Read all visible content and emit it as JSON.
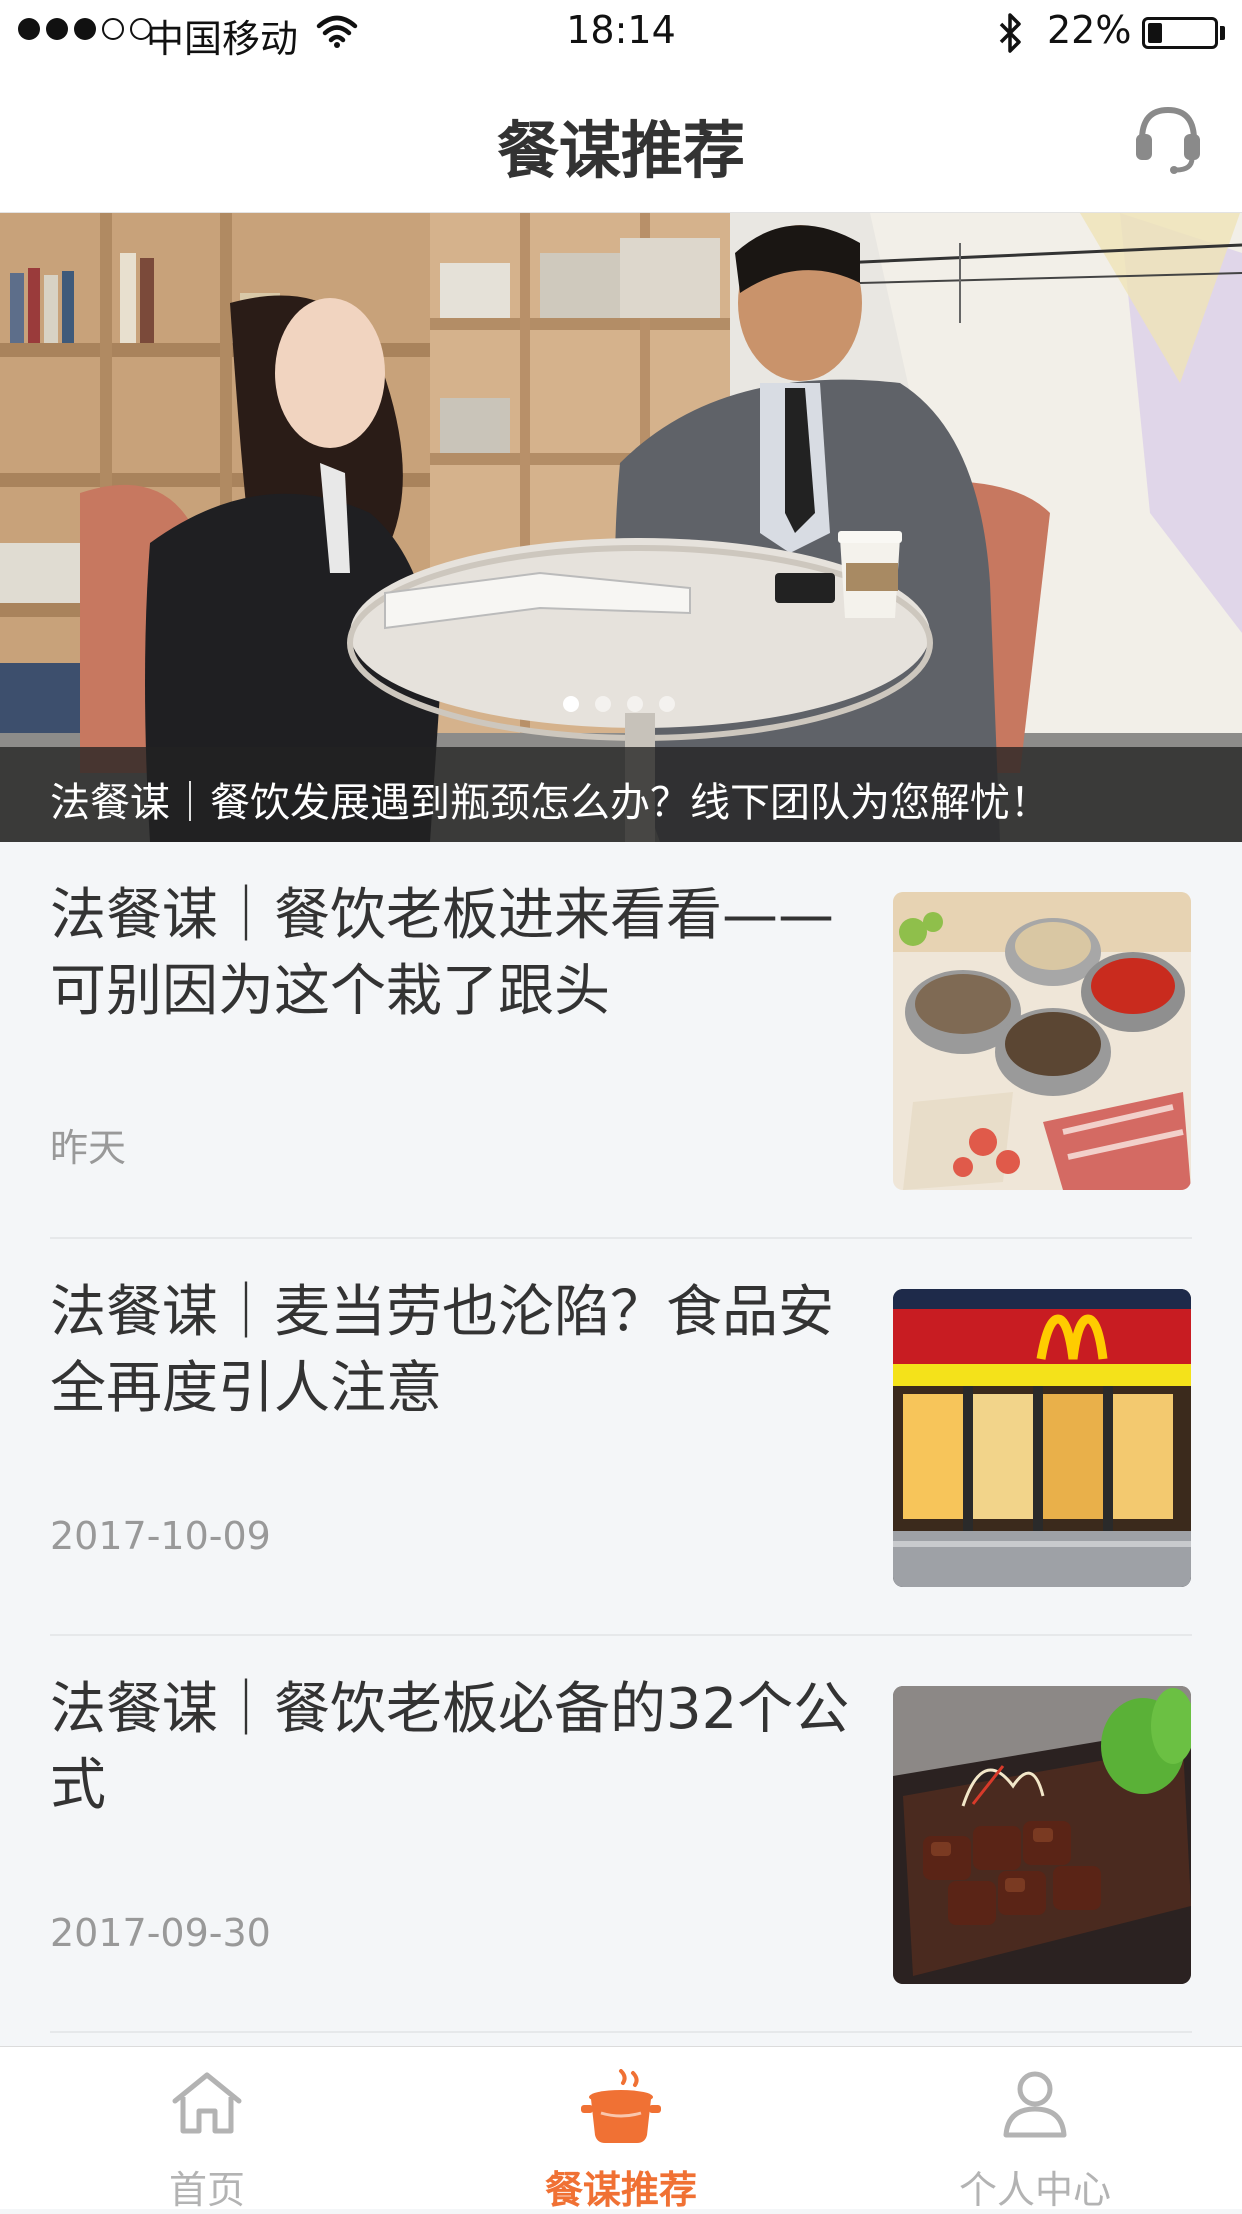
{
  "status_bar": {
    "carrier": "中国移动",
    "time": "18:14",
    "battery": "22%",
    "battery_level": 0.22
  },
  "nav": {
    "title": "餐谋推荐",
    "service_icon": "headset-icon"
  },
  "banner": {
    "caption": "法餐谋｜餐饮发展遇到瓶颈怎么办？线下团队为您解忧！",
    "dots_total": 4,
    "active_index": 0
  },
  "articles": [
    {
      "title": "法餐谋｜餐饮老板进来看看——可别因为这个栽了跟头",
      "date": "昨天",
      "thumb": "hotpot-image"
    },
    {
      "title": "法餐谋｜麦当劳也沦陷？食品安全再度引人注意",
      "date": "2017-10-09",
      "thumb": "mcdonalds-storefront-image"
    },
    {
      "title": "法餐谋｜餐饮老板必备的32个公式",
      "date": "2017-09-30",
      "thumb": "braised-meat-dish-image"
    }
  ],
  "tabbar": {
    "items": [
      {
        "label": "首页",
        "icon": "home-icon",
        "active": false
      },
      {
        "label": "餐谋推荐",
        "icon": "cooking-pot-icon",
        "active": true
      },
      {
        "label": "个人中心",
        "icon": "user-icon",
        "active": false
      }
    ],
    "active_color": "#f07134",
    "inactive_color": "#b3b3b3"
  }
}
